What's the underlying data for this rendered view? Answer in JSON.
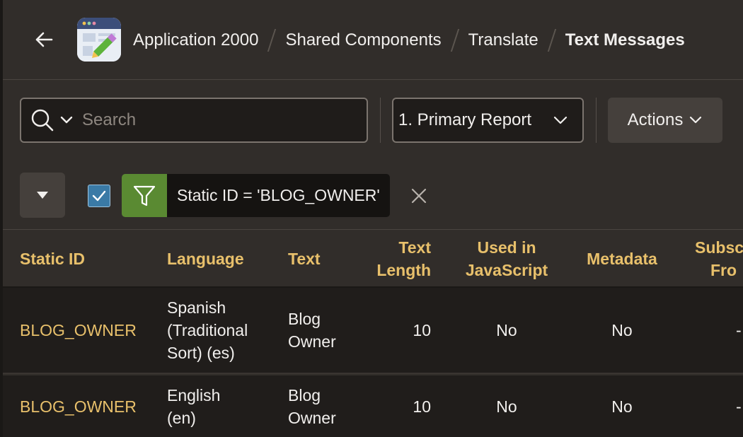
{
  "breadcrumb": {
    "items": [
      "Application 2000",
      "Shared Components",
      "Translate"
    ],
    "current": "Text Messages"
  },
  "toolbar": {
    "search_placeholder": "Search",
    "report_selected": "1. Primary Report",
    "actions_label": "Actions"
  },
  "filter": {
    "label": "Static ID = 'BLOG_OWNER'",
    "enabled": true
  },
  "table": {
    "columns": {
      "static_id": "Static ID",
      "language": "Language",
      "text": "Text",
      "text_length_1": "Text",
      "text_length_2": "Length",
      "used_js_1": "Used in",
      "used_js_2": "JavaScript",
      "metadata": "Metadata",
      "subscribed_1": "Subsc",
      "subscribed_2": "Fro"
    },
    "rows": [
      {
        "static_id": "BLOG_OWNER",
        "language_lines": [
          "Spanish",
          "(Traditional",
          "Sort) (es)"
        ],
        "text_lines": [
          "Blog",
          "Owner"
        ],
        "text_length": "10",
        "used_in_js": "No",
        "metadata": "No",
        "subscribed": "-"
      },
      {
        "static_id": "BLOG_OWNER",
        "language_lines": [
          "English",
          "(en)"
        ],
        "text_lines": [
          "Blog",
          "Owner"
        ],
        "text_length": "10",
        "used_in_js": "No",
        "metadata": "No",
        "subscribed": "-"
      }
    ]
  },
  "colors": {
    "background": "#312d2a",
    "accent_link": "#e8c06b",
    "filter_green": "#5a8a32",
    "checkbox_blue": "#3a7aa6"
  }
}
